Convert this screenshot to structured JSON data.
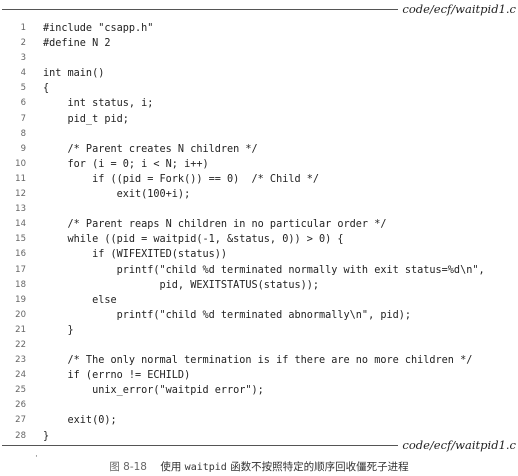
{
  "header_label": "code/ecf/waitpid1.c",
  "footer_label": "code/ecf/waitpid1.c",
  "code_lines": [
    {
      "num": "1",
      "text": "#include \"csapp.h\""
    },
    {
      "num": "2",
      "text": "#define N 2"
    },
    {
      "num": "3",
      "text": ""
    },
    {
      "num": "4",
      "text": "int main()"
    },
    {
      "num": "5",
      "text": "{"
    },
    {
      "num": "6",
      "text": "    int status, i;"
    },
    {
      "num": "7",
      "text": "    pid_t pid;"
    },
    {
      "num": "8",
      "text": ""
    },
    {
      "num": "9",
      "text": "    /* Parent creates N children */"
    },
    {
      "num": "10",
      "text": "    for (i = 0; i < N; i++)"
    },
    {
      "num": "11",
      "text": "        if ((pid = Fork()) == 0)  /* Child */"
    },
    {
      "num": "12",
      "text": "            exit(100+i);"
    },
    {
      "num": "13",
      "text": ""
    },
    {
      "num": "14",
      "text": "    /* Parent reaps N children in no particular order */"
    },
    {
      "num": "15",
      "text": "    while ((pid = waitpid(-1, &status, 0)) > 0) {"
    },
    {
      "num": "16",
      "text": "        if (WIFEXITED(status))"
    },
    {
      "num": "17",
      "text": "            printf(\"child %d terminated normally with exit status=%d\\n\","
    },
    {
      "num": "18",
      "text": "                   pid, WEXITSTATUS(status));"
    },
    {
      "num": "19",
      "text": "        else"
    },
    {
      "num": "20",
      "text": "            printf(\"child %d terminated abnormally\\n\", pid);"
    },
    {
      "num": "21",
      "text": "    }"
    },
    {
      "num": "22",
      "text": ""
    },
    {
      "num": "23",
      "text": "    /* The only normal termination is if there are no more children */"
    },
    {
      "num": "24",
      "text": "    if (errno != ECHILD)"
    },
    {
      "num": "25",
      "text": "        unix_error(\"waitpid error\");"
    },
    {
      "num": "26",
      "text": ""
    },
    {
      "num": "27",
      "text": "    exit(0);"
    },
    {
      "num": "28",
      "text": "}"
    }
  ],
  "stray_mark": "·",
  "caption": {
    "figure_number": "图 8-18",
    "prefix": "使用",
    "function_name": "waitpid",
    "suffix": "函数不按照特定的顺序回收僵死子进程"
  }
}
